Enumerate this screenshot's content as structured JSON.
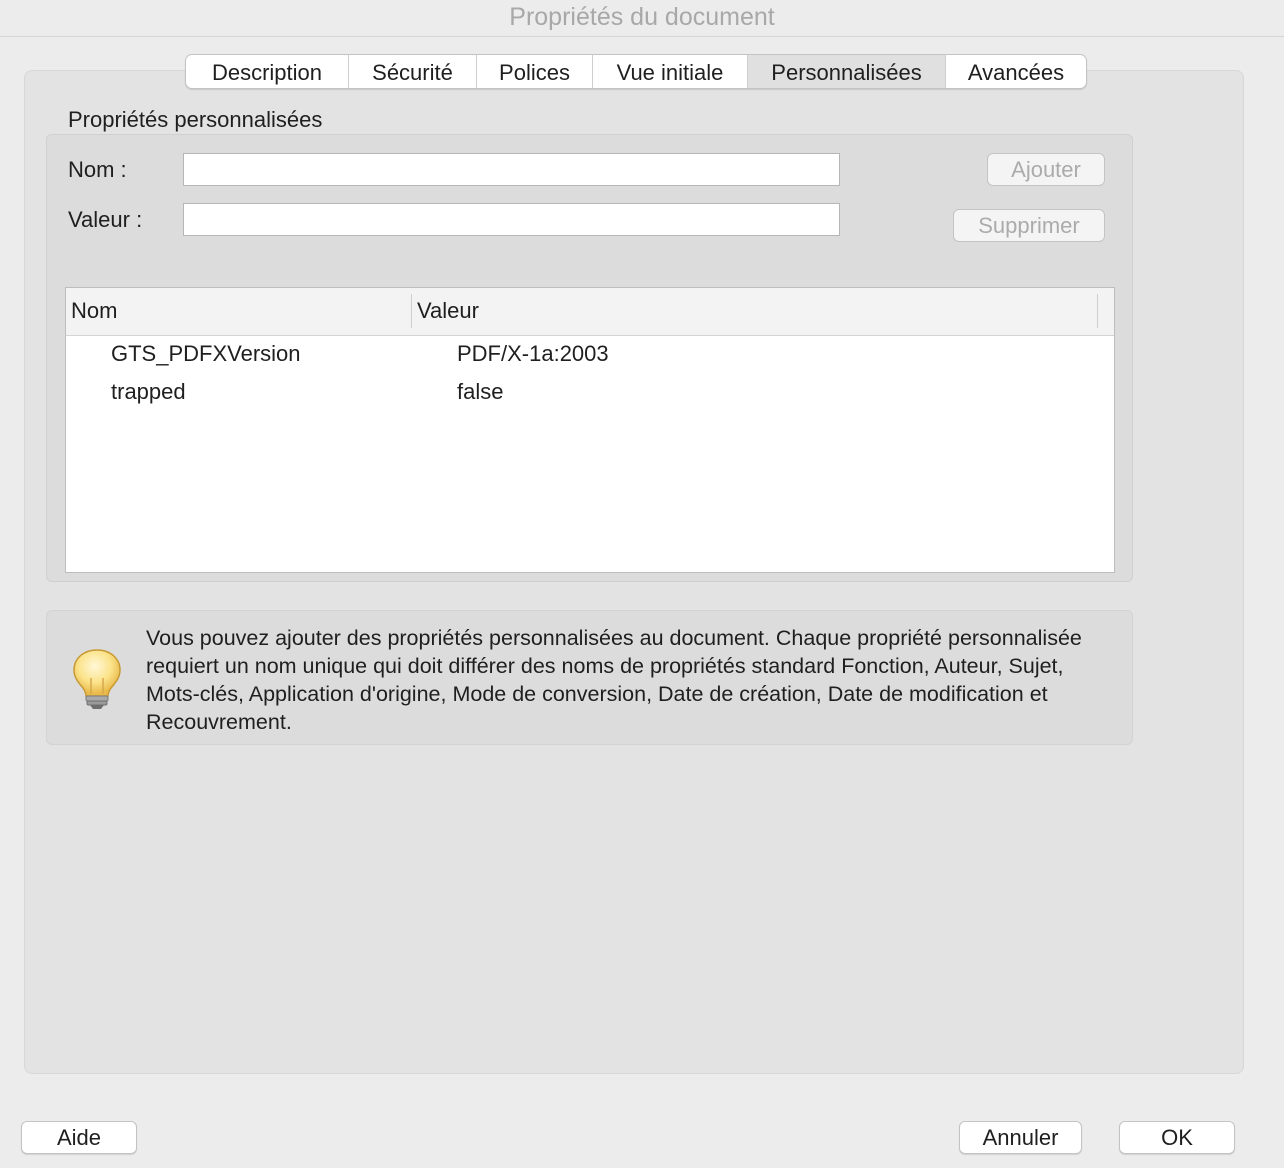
{
  "window": {
    "title": "Propriétés du document"
  },
  "tabs": [
    {
      "label": "Description",
      "active": false
    },
    {
      "label": "Sécurité",
      "active": false
    },
    {
      "label": "Polices",
      "active": false
    },
    {
      "label": "Vue initiale",
      "active": false
    },
    {
      "label": "Personnalisées",
      "active": true
    },
    {
      "label": "Avancées",
      "active": false
    }
  ],
  "custom": {
    "section_label": "Propriétés personnalisées",
    "name_label": "Nom :",
    "value_label": "Valeur :",
    "name_value": "",
    "value_value": "",
    "add_button": "Ajouter",
    "delete_button": "Supprimer"
  },
  "table": {
    "columns": [
      "Nom",
      "Valeur"
    ],
    "rows": [
      {
        "name": "GTS_PDFXVersion",
        "value": "PDF/X-1a:2003"
      },
      {
        "name": "trapped",
        "value": "false"
      }
    ]
  },
  "info": {
    "icon": "lightbulb-icon",
    "text": "Vous pouvez ajouter des propriétés personnalisées au document. Chaque propriété personnalisée requiert un nom unique qui doit différer des noms de propriétés standard Fonction, Auteur, Sujet, Mots-clés, Application d'origine, Mode de conversion, Date de création, Date de modification et Recouvrement."
  },
  "footer": {
    "help_button": "Aide",
    "cancel_button": "Annuler",
    "ok_button": "OK"
  }
}
